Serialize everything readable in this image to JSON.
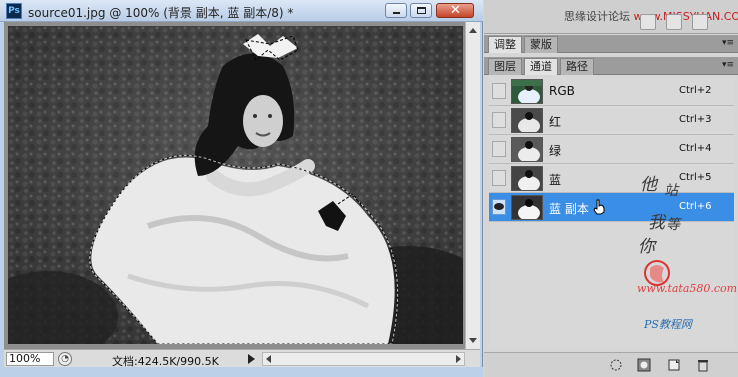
{
  "document": {
    "title": "source01.jpg @ 100% (背景 副本, 蓝 副本/8) *",
    "app_icon": "Ps",
    "zoom": "100%",
    "doc_size": "文档:424.5K/990.5K"
  },
  "panels": {
    "watermark_top": "思缘设计论坛",
    "watermark_top_site": "www.MISSYUAN.COM",
    "adjust_tabs": [
      {
        "label": "调整",
        "active": true
      },
      {
        "label": "蒙版",
        "active": false
      }
    ],
    "layer_tabs": [
      {
        "label": "图层",
        "active": false
      },
      {
        "label": "通道",
        "active": true
      },
      {
        "label": "路径",
        "active": false
      }
    ],
    "channels": [
      {
        "name": "RGB",
        "shortcut": "Ctrl+2",
        "visible": false,
        "selected": false,
        "thumb": "color"
      },
      {
        "name": "红",
        "shortcut": "Ctrl+3",
        "visible": false,
        "selected": false,
        "thumb": "gray"
      },
      {
        "name": "绿",
        "shortcut": "Ctrl+4",
        "visible": false,
        "selected": false,
        "thumb": "gray"
      },
      {
        "name": "蓝",
        "shortcut": "Ctrl+5",
        "visible": false,
        "selected": false,
        "thumb": "gray"
      },
      {
        "name": "蓝 副本",
        "shortcut": "Ctrl+6",
        "visible": true,
        "selected": true,
        "thumb": "gray"
      }
    ],
    "watermark_handwriting": [
      "他",
      "我",
      "你",
      "站",
      "等"
    ],
    "watermark_site": "www.tata580.com",
    "watermark_brand": "PS教程网"
  },
  "colors": {
    "selection_blue": "#3a8ee6",
    "titlebar": "#bcd0e8",
    "panel_bg": "#d6d6d6"
  }
}
